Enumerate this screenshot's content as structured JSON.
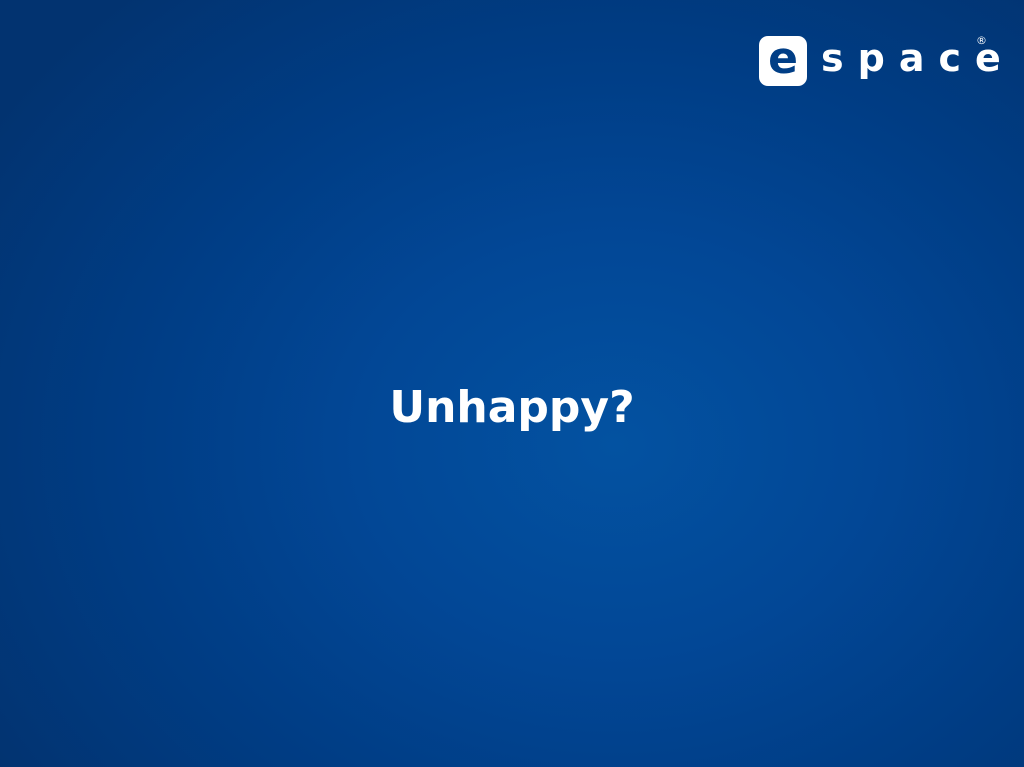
{
  "logo": {
    "badge_letter": "e",
    "wordmark": "space",
    "registered_mark": "®"
  },
  "slide": {
    "title": "Unhappy?"
  },
  "colors": {
    "background": "#024796",
    "logo_badge": "#ffffff",
    "text": "#ffffff"
  }
}
